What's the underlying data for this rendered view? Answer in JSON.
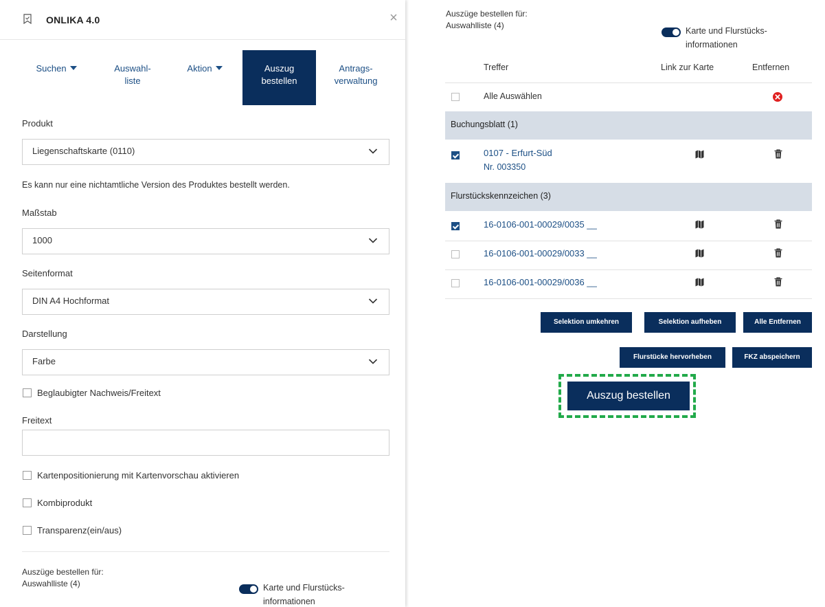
{
  "app": {
    "title": "ONLIKA 4.0"
  },
  "nav": [
    {
      "label": "Suchen",
      "has_caret": true
    },
    {
      "label_line1": "Auswahl-",
      "label_line2": "liste"
    },
    {
      "label": "Aktion",
      "has_caret": true
    },
    {
      "label_line1": "Auszug",
      "label_line2": "bestellen",
      "active": true
    },
    {
      "label_line1": "Antrags-",
      "label_line2": "verwaltung"
    }
  ],
  "form": {
    "product_label": "Produkt",
    "product_value": "Liegenschaftskarte (0110)",
    "info_text": "Es kann nur eine nichtamtliche Version des Produktes bestellt werden.",
    "scale_label": "Maßstab",
    "scale_value": "1000",
    "page_format_label": "Seitenformat",
    "page_format_value": "DIN A4 Hochformat",
    "display_label": "Darstellung",
    "display_value": "Farbe",
    "certified_label": "Beglaubigter Nachweis/Freitext",
    "freetext_label": "Freitext",
    "freetext_value": "",
    "map_positioning_label": "Kartenpositionierung mit Kartenvorschau aktivieren",
    "combo_label": "Kombiprodukt",
    "transparency_label": "Transparenz(ein/aus)",
    "order_for_line1": "Auszüge bestellen für:",
    "order_for_line2": "Auswahlliste (4)",
    "toggle_line1": "Karte und Flurstücks-",
    "toggle_line2": "informationen"
  },
  "results": {
    "order_for_line1": "Auszüge bestellen für:",
    "order_for_line2": "Auswahlliste (4)",
    "toggle_line1": "Karte und Flurstücks-",
    "toggle_line2": "informationen",
    "col_hits": "Treffer",
    "col_map_link": "Link zur Karte",
    "col_remove": "Entfernen",
    "select_all_label": "Alle Auswählen",
    "group_booking": "Buchungsblatt (1)",
    "booking_item": {
      "title": "0107 - Erfurt-Süd",
      "number": "Nr. 003350",
      "checked": true
    },
    "group_parcels": "Flurstückskennzeichen (3)",
    "parcels": [
      {
        "id": "16-0106-001-00029/0035 __",
        "checked": true
      },
      {
        "id": "16-0106-001-00029/0033 __",
        "checked": false
      },
      {
        "id": "16-0106-001-00029/0036 __",
        "checked": false
      }
    ]
  },
  "buttons": {
    "invert_selection": "Selektion umkehren",
    "clear_selection": "Selektion aufheben",
    "remove_all": "Alle Entfernen",
    "highlight_parcels": "Flurstücke hervorheben",
    "save_fkz": "FKZ abspeichern",
    "order_extract": "Auszug bestellen"
  },
  "colors": {
    "primary": "#0a2e5c",
    "link": "#1c4f85",
    "group_bg": "#d6dde6",
    "highlight": "#22aa4a",
    "remove_red": "#e02020"
  }
}
